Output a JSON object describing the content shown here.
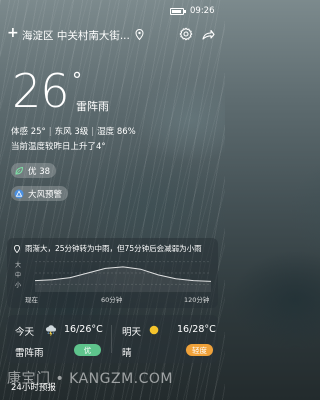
{
  "status_bar": {
    "time": "09:26"
  },
  "header": {
    "location": "海淀区 中关村南大街...",
    "add_label": "+"
  },
  "current": {
    "temperature": "26",
    "degree_symbol": "°",
    "condition": "雷阵雨",
    "feels_like": "体感 25°",
    "wind": "东风 3级",
    "humidity": "湿度 86%",
    "change_note": "当前温度较昨日上升了4°"
  },
  "aqi": {
    "label": "优 38"
  },
  "alert": {
    "label": "大风预警"
  },
  "rain": {
    "summary": "雨渐大，25分钟转为中雨，但75分钟后会减弱为小雨",
    "levels": [
      "大",
      "中",
      "小"
    ],
    "time_labels": [
      "现在",
      "60分钟",
      "120分钟"
    ],
    "intensity_curve": [
      0.3,
      0.32,
      0.38,
      0.5,
      0.62,
      0.66,
      0.6,
      0.45,
      0.35,
      0.3,
      0.28
    ]
  },
  "forecast": {
    "today": {
      "day": "今天",
      "temp": "16/26°C",
      "condition": "雷阵雨",
      "aqi": "优",
      "icon": "thunder-rain-icon",
      "aqi_color": "#5ec48c"
    },
    "tomorrow": {
      "day": "明天",
      "temp": "16/28°C",
      "condition": "晴",
      "aqi": "轻度",
      "icon": "sun-icon",
      "aqi_color": "#f0a23a"
    }
  },
  "section_24h": {
    "label": "24小时预报"
  },
  "watermark": {
    "text": "康宝门 • KANGZM.COM"
  }
}
